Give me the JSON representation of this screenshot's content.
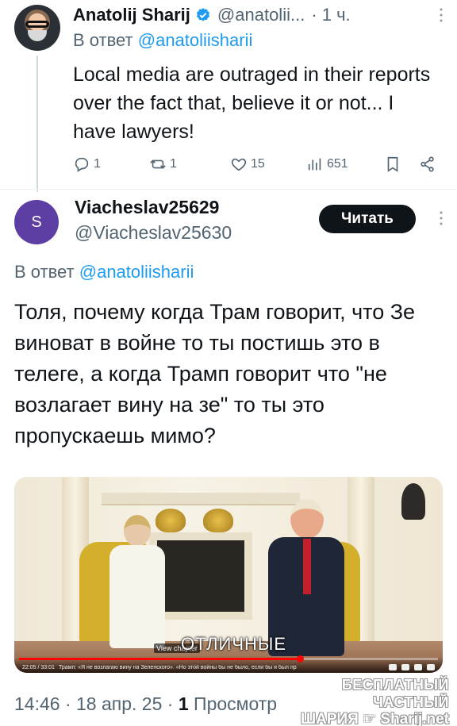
{
  "tweet1": {
    "name": "Anatolij Sharij",
    "handle": "@anatolii...",
    "time": "· 1 ч.",
    "reply_prefix": "В ответ ",
    "reply_mention": "@anatoliisharii",
    "text": "Local media are outraged in their reports over the fact that, believe it or not... I have lawyers!",
    "counts": {
      "replies": "1",
      "retweets": "1",
      "likes": "15",
      "views": "651"
    }
  },
  "tweet2": {
    "avatar_letter": "S",
    "name": "Viacheslav25629",
    "handle": "@Viacheslav25630",
    "follow_label": "Читать",
    "reply_prefix": "В ответ ",
    "reply_mention": "@anatoliisharii",
    "text": "Толя, почему когда Трам говорит, что Зе виноват в войне то ты постишь это в телеге, а когда Трамп говорит что \"не возлагает вину на зе\" то ты это пропускаешь мимо?"
  },
  "media": {
    "caption": "ОТЛИЧНЫЕ",
    "chapter_label": "View chapter",
    "time": "22:05 / 33:01",
    "title": "Трамп: «Я не возлагаю вину на Зеленского». «Но этой войны бы не было, если бы я был президентом»",
    "progress": 0.67
  },
  "footer": {
    "time": "14:46",
    "date": "18 апр. 25",
    "views_count": "1",
    "views_label": "Просмотр"
  },
  "watermark": {
    "line1": "БЕСПЛАТНЫЙ ЧАСТНЫЙ",
    "line2a": "ШАРИЯ",
    "line2b": "Sharij.net"
  },
  "colors": {
    "accent": "#1d9bf0",
    "text": "#0f1419",
    "muted": "#536471",
    "avatar2_bg": "#5d3fa3",
    "button_bg": "#0f1419"
  }
}
